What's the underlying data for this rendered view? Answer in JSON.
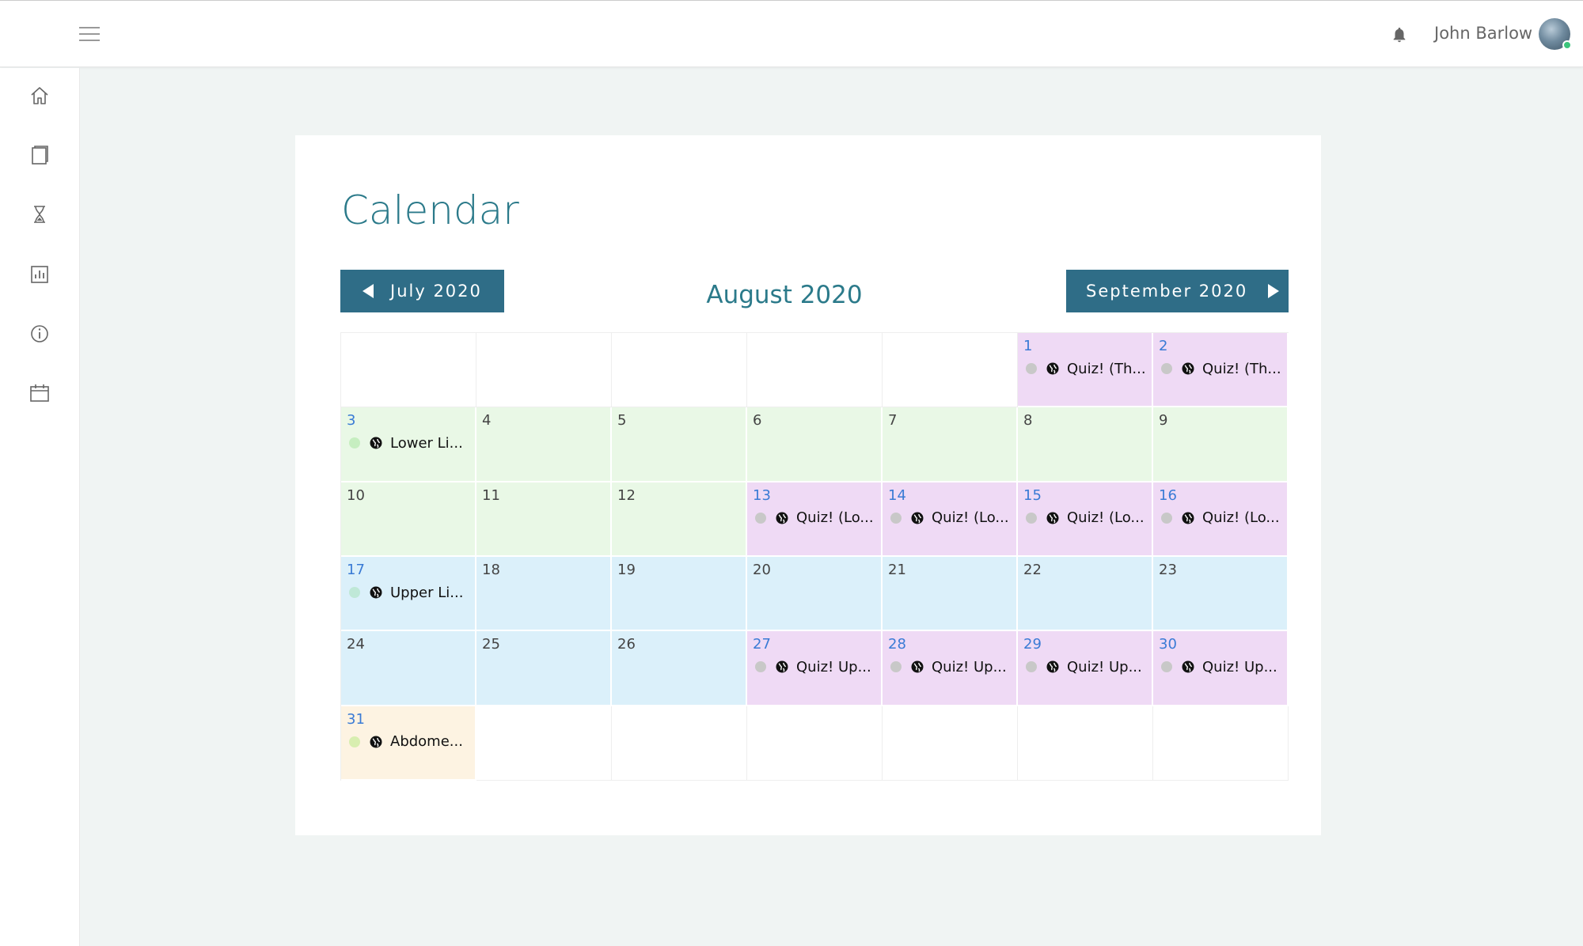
{
  "header": {
    "username": "John Barlow",
    "menu_icon": "hamburger-menu-icon",
    "notification_icon": "bell-icon"
  },
  "sidebar": {
    "items": [
      {
        "name": "home",
        "icon": "home-icon"
      },
      {
        "name": "book",
        "icon": "book-icon"
      },
      {
        "name": "hourglass",
        "icon": "hourglass-icon"
      },
      {
        "name": "stats",
        "icon": "bar-chart-icon"
      },
      {
        "name": "info",
        "icon": "info-icon"
      },
      {
        "name": "calendar",
        "icon": "calendar-icon"
      }
    ]
  },
  "page": {
    "title": "Calendar",
    "prev_month": "July 2020",
    "current_month": "August 2020",
    "next_month": "September 2020"
  },
  "colors": {
    "accent": "#2b7a8a",
    "button": "#2f6d87",
    "purple": "#efdaf5",
    "green": "#e9f8e6",
    "blue": "#dbf0fa",
    "cream": "#fdf3e2"
  },
  "calendar": {
    "weeks": [
      [
        {
          "day": ""
        },
        {
          "day": ""
        },
        {
          "day": ""
        },
        {
          "day": ""
        },
        {
          "day": ""
        },
        {
          "day": "1",
          "color": "purple",
          "linked": true,
          "event": "Quiz! (Th...",
          "dot": "#c8c8c8"
        },
        {
          "day": "2",
          "color": "purple",
          "linked": true,
          "event": "Quiz! (Th...",
          "dot": "#c8c8c8"
        }
      ],
      [
        {
          "day": "3",
          "color": "green",
          "linked": true,
          "event": "Lower Li...",
          "dot": "#c6eec0"
        },
        {
          "day": "4",
          "color": "green"
        },
        {
          "day": "5",
          "color": "green"
        },
        {
          "day": "6",
          "color": "green"
        },
        {
          "day": "7",
          "color": "green"
        },
        {
          "day": "8",
          "color": "green"
        },
        {
          "day": "9",
          "color": "green"
        }
      ],
      [
        {
          "day": "10",
          "color": "green"
        },
        {
          "day": "11",
          "color": "green"
        },
        {
          "day": "12",
          "color": "green"
        },
        {
          "day": "13",
          "color": "purple",
          "linked": true,
          "event": "Quiz! (Lo...",
          "dot": "#c8c8c8"
        },
        {
          "day": "14",
          "color": "purple",
          "linked": true,
          "event": "Quiz! (Lo...",
          "dot": "#c8c8c8"
        },
        {
          "day": "15",
          "color": "purple",
          "linked": true,
          "event": "Quiz! (Lo...",
          "dot": "#c8c8c8"
        },
        {
          "day": "16",
          "color": "purple",
          "linked": true,
          "event": "Quiz! (Lo...",
          "dot": "#c8c8c8"
        }
      ],
      [
        {
          "day": "17",
          "color": "blue",
          "linked": true,
          "event": "Upper Li...",
          "dot": "#bfe8d7"
        },
        {
          "day": "18",
          "color": "blue"
        },
        {
          "day": "19",
          "color": "blue"
        },
        {
          "day": "20",
          "color": "blue"
        },
        {
          "day": "21",
          "color": "blue"
        },
        {
          "day": "22",
          "color": "blue"
        },
        {
          "day": "23",
          "color": "blue"
        }
      ],
      [
        {
          "day": "24",
          "color": "blue"
        },
        {
          "day": "25",
          "color": "blue"
        },
        {
          "day": "26",
          "color": "blue"
        },
        {
          "day": "27",
          "color": "purple",
          "linked": true,
          "event": "Quiz! Up...",
          "dot": "#c8c8c8"
        },
        {
          "day": "28",
          "color": "purple",
          "linked": true,
          "event": "Quiz! Up...",
          "dot": "#c8c8c8"
        },
        {
          "day": "29",
          "color": "purple",
          "linked": true,
          "event": "Quiz! Up...",
          "dot": "#c8c8c8"
        },
        {
          "day": "30",
          "color": "purple",
          "linked": true,
          "event": "Quiz! Up...",
          "dot": "#c8c8c8"
        }
      ],
      [
        {
          "day": "31",
          "color": "cream",
          "linked": true,
          "event": "Abdome...",
          "dot": "#d8eeb0"
        },
        {
          "day": ""
        },
        {
          "day": ""
        },
        {
          "day": ""
        },
        {
          "day": ""
        },
        {
          "day": ""
        },
        {
          "day": ""
        }
      ]
    ]
  }
}
